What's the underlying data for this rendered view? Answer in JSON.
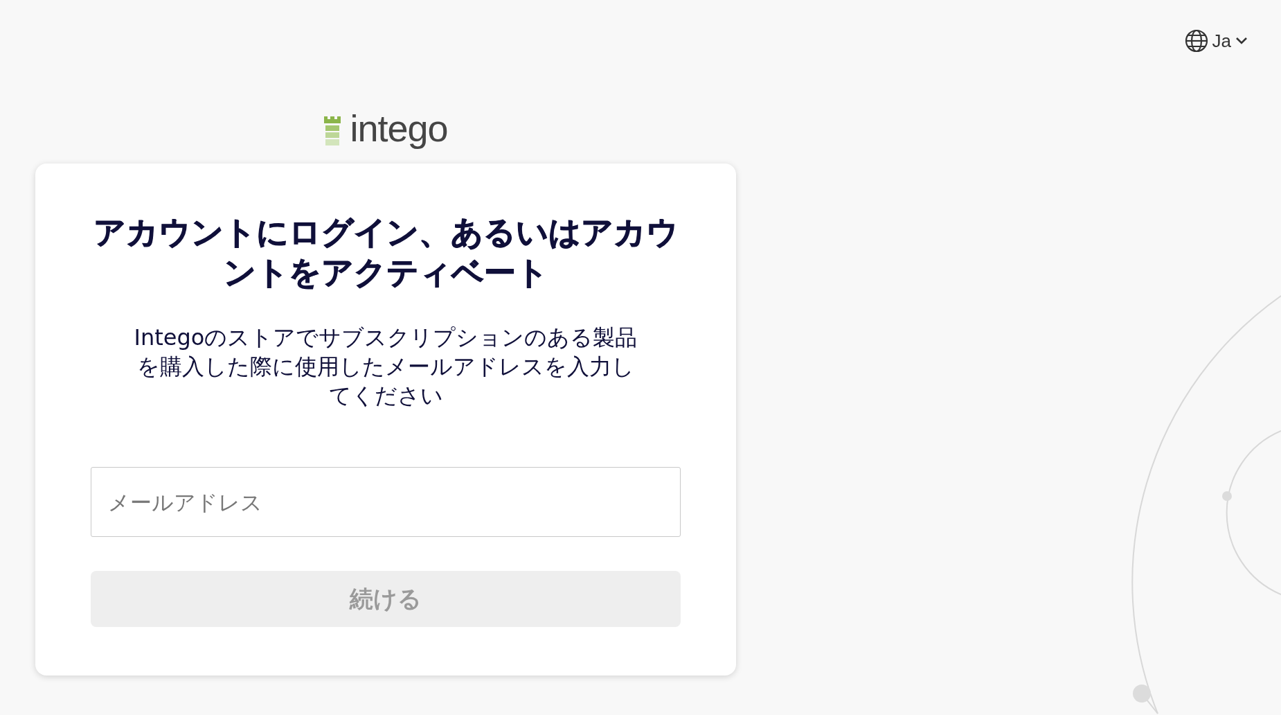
{
  "language_selector": {
    "label": "Ja"
  },
  "logo": {
    "text": "intego"
  },
  "login_card": {
    "title": "アカウントにログイン、あるいはアカウントをアクティベート",
    "description": "Integoのストアでサブスクリプションのある製品を購入した際に使用したメールアドレスを入力してください",
    "email_field": {
      "placeholder": "メールアドレス"
    },
    "continue_button": {
      "label": "続ける",
      "disabled": true
    }
  }
}
